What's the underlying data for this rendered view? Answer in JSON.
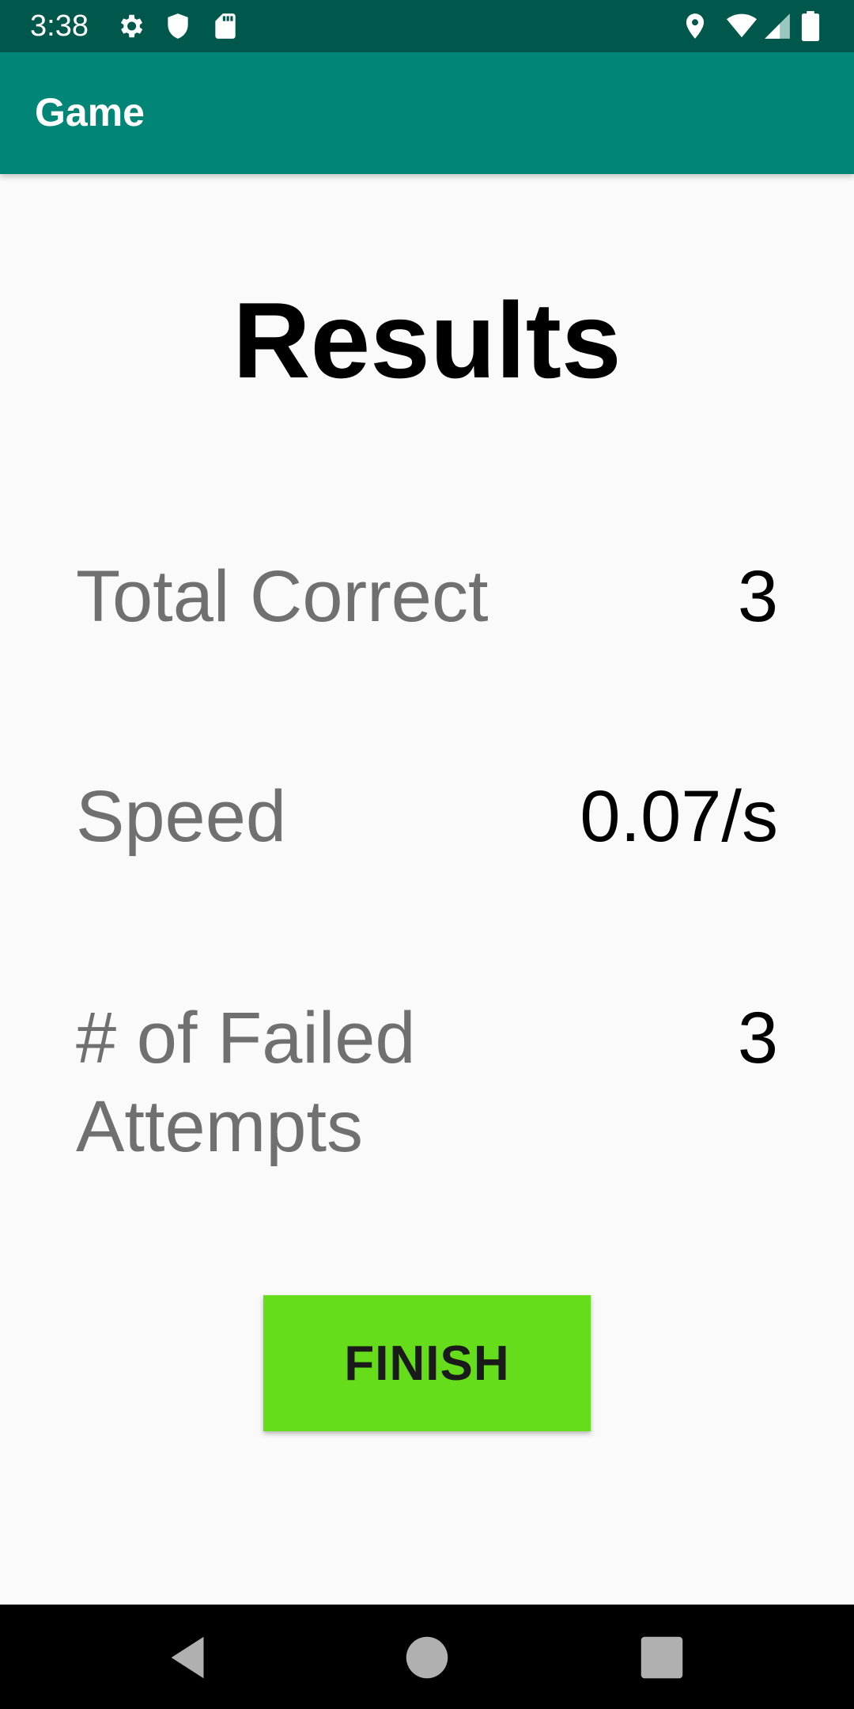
{
  "status_bar": {
    "time": "3:38",
    "icons_left": [
      "settings-icon",
      "shield-icon",
      "sd-card-icon"
    ],
    "icons_right": [
      "location-icon",
      "wifi-icon",
      "signal-icon",
      "battery-icon"
    ]
  },
  "app_bar": {
    "title": "Game",
    "color": "#008577"
  },
  "results": {
    "title": "Results",
    "stats": [
      {
        "label": "Total Correct",
        "value": "3"
      },
      {
        "label": "Speed",
        "value": "0.07/s"
      },
      {
        "label": "# of Failed Attempts",
        "value": "3"
      }
    ]
  },
  "finish_button": {
    "label": "FINISH",
    "color": "#66dd1a"
  },
  "nav_bar": {
    "buttons": [
      "back-icon",
      "home-icon",
      "recents-icon"
    ]
  }
}
